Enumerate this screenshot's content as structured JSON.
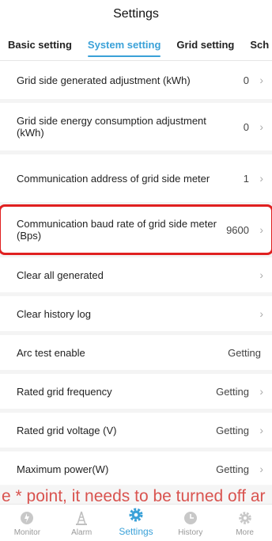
{
  "header": {
    "title": "Settings"
  },
  "tabs": [
    {
      "label": "Basic setting"
    },
    {
      "label": "System setting"
    },
    {
      "label": "Grid setting"
    },
    {
      "label": "Sch"
    }
  ],
  "rows": [
    {
      "label": "Grid side generated adjustment (kWh)",
      "value": "0"
    },
    {
      "label": "Grid side energy consumption adjustment (kWh)",
      "value": "0"
    },
    {
      "label": "Communication address of grid side meter",
      "value": "1"
    },
    {
      "label": "Communication baud rate of grid side meter (Bps)",
      "value": "9600"
    },
    {
      "label": "Clear all generated",
      "value": ""
    },
    {
      "label": "Clear history log",
      "value": ""
    },
    {
      "label": "Arc test enable",
      "value": "Getting"
    },
    {
      "label": "Rated grid frequency",
      "value": "Getting"
    },
    {
      "label": "Rated grid voltage (V)",
      "value": "Getting"
    },
    {
      "label": "Maximum power(W)",
      "value": "Getting"
    }
  ],
  "toast": {
    "text": "e * point, it needs to be turned off ar"
  },
  "nav": [
    {
      "label": "Monitor",
      "icon": "monitor-icon"
    },
    {
      "label": "Alarm",
      "icon": "alarm-icon"
    },
    {
      "label": "Settings",
      "icon": "settings-gear-icon"
    },
    {
      "label": "History",
      "icon": "history-clock-icon"
    },
    {
      "label": "More",
      "icon": "more-gear-icon"
    }
  ],
  "colors": {
    "accent": "#3aa1d8",
    "highlight": "#e02020",
    "toast": "#d9534f"
  }
}
